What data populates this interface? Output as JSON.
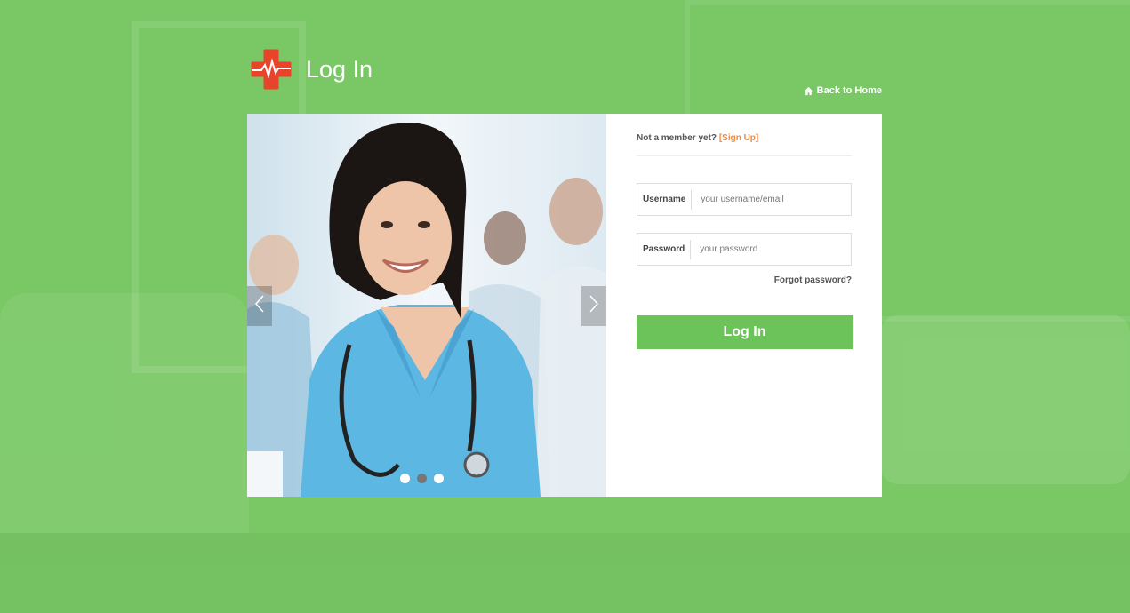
{
  "header": {
    "title": "Log In",
    "logo_icon": "medical-cross-heartbeat-icon",
    "back_home_label": "Back to Home",
    "back_home_icon": "home-icon"
  },
  "slider": {
    "image": "smiling-nurse-with-stethoscope",
    "prev_icon": "chevron-left-icon",
    "next_icon": "chevron-right-icon",
    "dots": 3,
    "active_dot": 2
  },
  "form": {
    "not_member_text": "Not a member yet?",
    "signup_link": "[Sign Up]",
    "username_label": "Username",
    "username_placeholder": "your username/email",
    "password_label": "Password",
    "password_placeholder": "your password",
    "forgot_password": "Forgot password?",
    "submit_label": "Log In"
  },
  "colors": {
    "background": "#79c865",
    "button": "#6cc35a",
    "signup_link": "#f08a43",
    "logo": "#e8432b"
  }
}
